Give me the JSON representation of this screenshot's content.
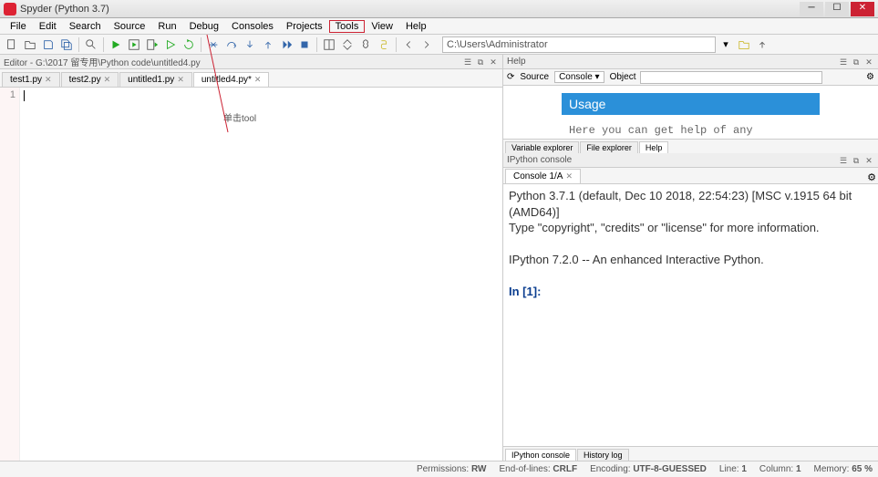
{
  "window": {
    "title": "Spyder (Python 3.7)"
  },
  "menus": [
    "File",
    "Edit",
    "Search",
    "Source",
    "Run",
    "Debug",
    "Consoles",
    "Projects",
    "Tools",
    "View",
    "Help"
  ],
  "menu_highlight_index": 8,
  "toolbar_path": "C:\\Users\\Administrator",
  "editor": {
    "header": "Editor - G:\\2017 留专用\\Python code\\untitled4.py",
    "tabs": [
      {
        "label": "test1.py",
        "active": false
      },
      {
        "label": "test2.py",
        "active": false
      },
      {
        "label": "untitled1.py",
        "active": false
      },
      {
        "label": "untitled4.py*",
        "active": true
      }
    ],
    "line_number": "1",
    "annotation": "单击tool"
  },
  "help": {
    "header": "Help",
    "source_label": "Source",
    "source_value": "Console",
    "object_label": "Object",
    "usage_title": "Usage",
    "usage_text": "Here you can get help of any",
    "subtabs": [
      "Variable explorer",
      "File explorer",
      "Help"
    ],
    "active_subtab": 2
  },
  "ipython": {
    "header": "IPython console",
    "tab": "Console 1/A",
    "lines": [
      "Python 3.7.1 (default, Dec 10 2018, 22:54:23) [MSC v.1915 64 bit (AMD64)]",
      "Type \"copyright\", \"credits\" or \"license\" for more information.",
      "",
      "IPython 7.2.0 -- An enhanced Interactive Python.",
      ""
    ],
    "prompt": "In [1]: ",
    "bottom_tabs": [
      "IPython console",
      "History log"
    ]
  },
  "statusbar": {
    "permissions_label": "Permissions:",
    "permissions": "RW",
    "eol_label": "End-of-lines:",
    "eol": "CRLF",
    "encoding_label": "Encoding:",
    "encoding": "UTF-8-GUESSED",
    "line_label": "Line:",
    "line": "1",
    "column_label": "Column:",
    "column": "1",
    "memory_label": "Memory:",
    "memory": "65 %"
  },
  "chart_data": null
}
